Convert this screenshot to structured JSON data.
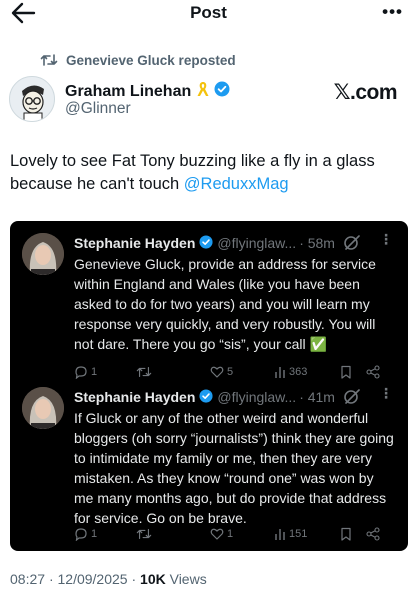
{
  "topbar": {
    "title": "Post"
  },
  "repost": {
    "text": "Genevieve Gluck reposted"
  },
  "author": {
    "name": "Graham Linehan",
    "handle": "@Glinner",
    "watermark": "𝕏.com"
  },
  "tweet": {
    "text": "Lovely to see Fat Tony buzzing like a fly in a glass because he can't touch ",
    "mention": "@ReduxxMag"
  },
  "embed": {
    "posts": [
      {
        "name": "Stephanie Hayden",
        "handle": "@flyinglaw...",
        "time": "· 58m",
        "text": "Genevieve Gluck, provide an address for service within England and Wales (like you have been asked to do for two years) and you will learn my response very quickly, and very robustly. You will not dare. There you go “sis”, your call ✅",
        "replies": "1",
        "retweets": "",
        "likes": "5",
        "views": "363"
      },
      {
        "name": "Stephanie Hayden",
        "handle": "@flyinglaw...",
        "time": "· 41m",
        "text": "If Gluck or any of the other weird and wonderful bloggers (oh sorry “journalists”) think they are going to intimidate my family or me, then they are very mistaken. As they know “round one” was won by me many months ago, but do provide that address for service. Go on be brave.",
        "replies": "1",
        "retweets": "",
        "likes": "1",
        "views": "151"
      }
    ]
  },
  "meta": {
    "time": "08:27",
    "date": "12/09/2025",
    "views_count": "10K",
    "views_label": "Views"
  },
  "colors": {
    "link": "#1d9bf0",
    "verified": "#1d9bf0",
    "secondary": "#536471",
    "embed_bg": "#000000"
  },
  "icons": [
    "back-arrow-icon",
    "more-icon",
    "repost-icon",
    "ribbon-icon",
    "verified-icon",
    "grok-icon",
    "reply-icon",
    "retweet-icon",
    "like-icon",
    "views-icon",
    "bookmark-icon",
    "share-icon"
  ]
}
